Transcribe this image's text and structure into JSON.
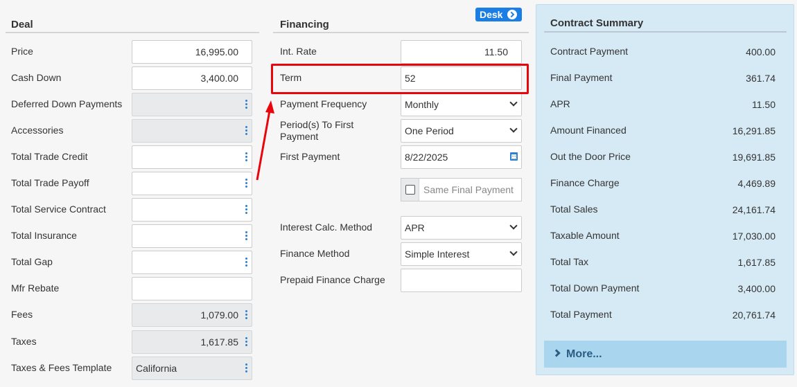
{
  "deal": {
    "title": "Deal",
    "rows": [
      {
        "label": "Price",
        "value": "16,995.00",
        "kind": "input"
      },
      {
        "label": "Cash Down",
        "value": "3,400.00",
        "kind": "input"
      },
      {
        "label": "Deferred Down Payments",
        "value": "",
        "kind": "readonly-menu"
      },
      {
        "label": "Accessories",
        "value": "",
        "kind": "readonly-menu"
      },
      {
        "label": "Total Trade Credit",
        "value": "",
        "kind": "menu"
      },
      {
        "label": "Total Trade Payoff",
        "value": "",
        "kind": "menu"
      },
      {
        "label": "Total Service Contract",
        "value": "",
        "kind": "menu"
      },
      {
        "label": "Total Insurance",
        "value": "",
        "kind": "menu"
      },
      {
        "label": "Total Gap",
        "value": "",
        "kind": "menu"
      },
      {
        "label": "Mfr Rebate",
        "value": "",
        "kind": "input"
      },
      {
        "label": "Fees",
        "value": "1,079.00",
        "kind": "readonly-menu"
      },
      {
        "label": "Taxes",
        "value": "1,617.85",
        "kind": "readonly-menu"
      },
      {
        "label": "Taxes & Fees Template",
        "value": "California",
        "kind": "readonly-menu-left"
      }
    ]
  },
  "financing": {
    "title": "Financing",
    "desk_label": "Desk",
    "int_rate_label": "Int. Rate",
    "int_rate_value": "11.50",
    "term_label": "Term",
    "term_value": "52",
    "payment_frequency_label": "Payment Frequency",
    "payment_frequency_value": "Monthly",
    "periods_label_1": "Period(s) To First",
    "periods_label_2": "Payment",
    "periods_value": "One Period",
    "first_payment_label": "First Payment",
    "first_payment_value": "8/22/2025",
    "same_final_payment_label": "Same Final Payment",
    "same_final_payment_checked": false,
    "interest_calc_label": "Interest Calc. Method",
    "interest_calc_value": "APR",
    "finance_method_label": "Finance Method",
    "finance_method_value": "Simple Interest",
    "prepaid_finance_label": "Prepaid Finance Charge",
    "prepaid_finance_value": ""
  },
  "summary": {
    "title": "Contract Summary",
    "rows": [
      {
        "label": "Contract Payment",
        "value": "400.00"
      },
      {
        "label": "Final Payment",
        "value": "361.74"
      },
      {
        "label": "APR",
        "value": "11.50"
      },
      {
        "label": "Amount Financed",
        "value": "16,291.85"
      },
      {
        "label": "Out the Door Price",
        "value": "19,691.85"
      },
      {
        "label": "Finance Charge",
        "value": "4,469.89"
      },
      {
        "label": "Total Sales",
        "value": "24,161.74"
      },
      {
        "label": "Taxable Amount",
        "value": "17,030.00"
      },
      {
        "label": "Total Tax",
        "value": "1,617.85"
      },
      {
        "label": "Total Down Payment",
        "value": "3,400.00"
      },
      {
        "label": "Total Payment",
        "value": "20,761.74"
      }
    ],
    "more_label": "More..."
  },
  "colors": {
    "accent": "#1a7ee5",
    "highlight": "#e8060c",
    "summary_bg": "#d6eaf5"
  }
}
